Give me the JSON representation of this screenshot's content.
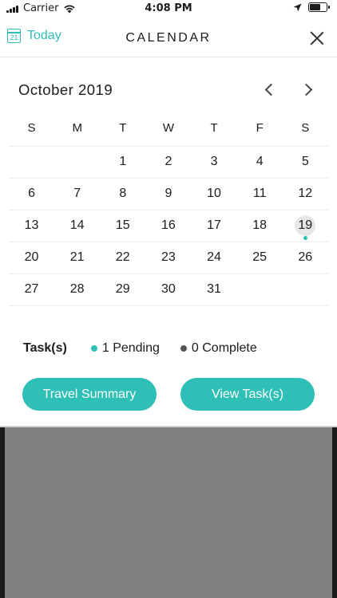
{
  "status_bar": {
    "carrier": "Carrier",
    "time": "4:08 PM"
  },
  "header": {
    "today_icon_day": "21",
    "today_label": "Today",
    "title": "CALENDAR"
  },
  "calendar": {
    "month_label": "October 2019",
    "weekdays": [
      "S",
      "M",
      "T",
      "W",
      "T",
      "F",
      "S"
    ],
    "weeks": [
      [
        "",
        "",
        "1",
        "2",
        "3",
        "4",
        "5"
      ],
      [
        "6",
        "7",
        "8",
        "9",
        "10",
        "11",
        "12"
      ],
      [
        "13",
        "14",
        "15",
        "16",
        "17",
        "18",
        "19"
      ],
      [
        "20",
        "21",
        "22",
        "23",
        "24",
        "25",
        "26"
      ],
      [
        "27",
        "28",
        "29",
        "30",
        "31",
        "",
        ""
      ]
    ],
    "selected_day": "19",
    "days_with_tasks": [
      "19"
    ]
  },
  "tasks": {
    "label": "Task(s)",
    "pending_text": "1 Pending",
    "complete_text": "0 Complete"
  },
  "buttons": {
    "travel_summary": "Travel Summary",
    "view_tasks": "View Task(s)"
  },
  "colors": {
    "accent": "#2ebfb7",
    "complete_dot": "#555555",
    "selected_day_bg": "#e6e6e6",
    "backdrop": "#808080"
  }
}
